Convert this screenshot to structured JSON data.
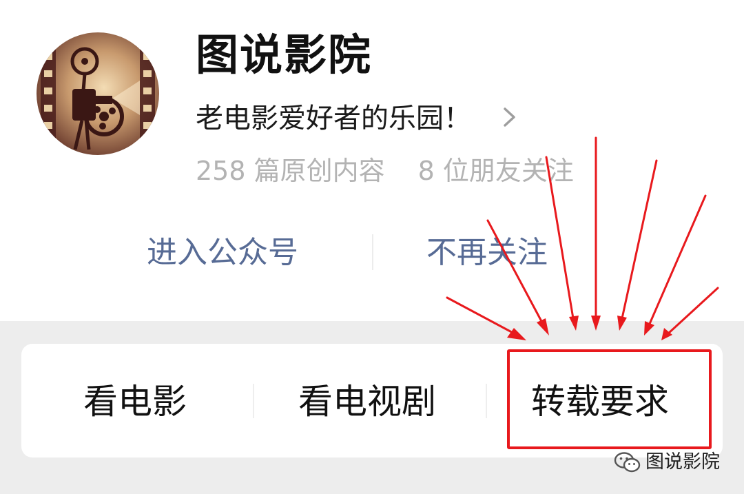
{
  "account": {
    "name": "图说影院",
    "description": "老电影爱好者的乐园！",
    "stats": {
      "original_count": "258 篇原创内容",
      "friends_following": "8 位朋友关注"
    }
  },
  "actions": {
    "enter": "进入公众号",
    "unfollow": "不再关注"
  },
  "menu": {
    "items": [
      {
        "label": "看电影"
      },
      {
        "label": "看电视剧"
      },
      {
        "label": "转载要求"
      }
    ]
  },
  "watermark": {
    "text": "图说影院"
  },
  "colors": {
    "link": "#576b95",
    "highlight": "#e8191d",
    "muted": "#b3b3b3"
  }
}
